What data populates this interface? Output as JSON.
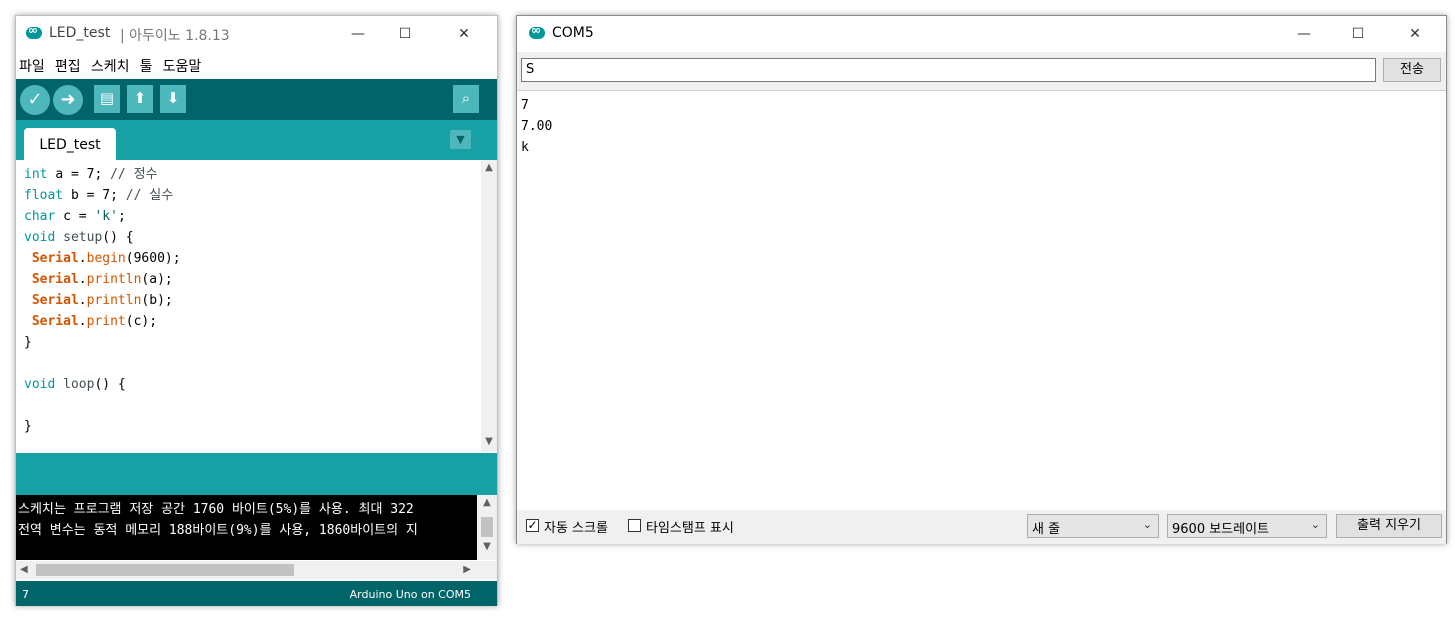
{
  "ide": {
    "title_name": "LED_test",
    "title_rest": "| 아두이노 1.8.13",
    "window_controls": {
      "minimize": "—",
      "maximize": "☐",
      "close": "✕"
    },
    "menu": [
      "파일",
      "편집",
      "스케치",
      "툴",
      "도움말"
    ],
    "toolbar_icons": [
      "verify-icon",
      "upload-icon",
      "new-icon",
      "open-icon",
      "save-icon",
      "serial-monitor-icon"
    ],
    "tab_label": "LED_test",
    "code_lines": [
      "int a = 7; // 정수",
      "float b = 7; // 실수",
      "char c = 'k';",
      "void setup() {",
      " Serial.begin(9600);",
      " Serial.println(a);",
      " Serial.println(b);",
      " Serial.print(c);",
      "}",
      "",
      "void loop() {",
      "",
      "}"
    ],
    "console_lines": [
      "스케치는 프로그램 저장 공간 1760 바이트(5%)를 사용. 최대 322",
      "전역 변수는 동적 메모리 188바이트(9%)를 사용, 1860바이트의 지"
    ],
    "footer_line": "7",
    "footer_board": "Arduino Uno on COM5",
    "accent_dark": "#006468",
    "accent_mid": "#17a1a5",
    "accent_light": "#4db7bb"
  },
  "serial": {
    "title": "COM5",
    "input_value": "S",
    "send_label": "전송",
    "output_lines": [
      "7",
      "7.00",
      "k"
    ],
    "autoscroll_label": "자동 스크롤",
    "autoscroll_checked": true,
    "timestamp_label": "타임스탬프 표시",
    "timestamp_checked": false,
    "line_ending_selected": "새 줄",
    "baud_selected": "9600 보드레이트",
    "clear_label": "출력 지우기"
  }
}
